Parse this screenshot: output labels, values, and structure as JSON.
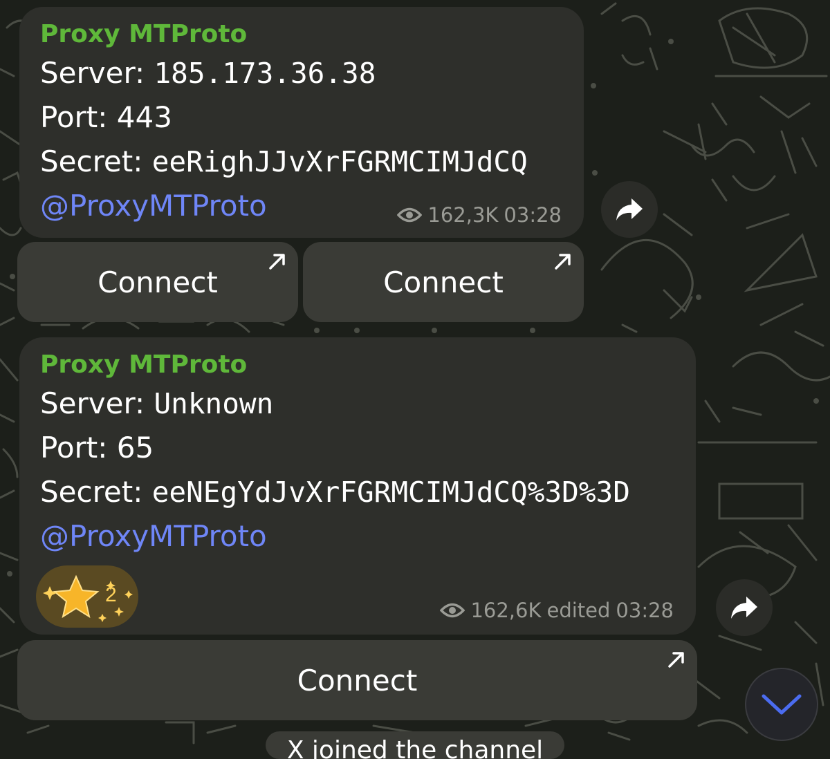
{
  "messages": [
    {
      "sender": "Proxy MTProto",
      "server_label": "Server: ",
      "server_value": "185.173.36.38",
      "port_label": "Port: ",
      "port_value": "443",
      "secret_label": "Secret: ",
      "secret_value": "eeRighJJvXrFGRMCIMJdCQ",
      "link": "@ProxyMTProto",
      "views": "162,3K",
      "time": "03:28",
      "buttons": [
        "Connect",
        "Connect"
      ]
    },
    {
      "sender": "Proxy MTProto",
      "server_label": "Server: ",
      "server_value": "Unknown",
      "port_label": "Port: ",
      "port_value": "65",
      "secret_label": "Secret: ",
      "secret_value": "eeNEgYdJvXrFGRMCIMJdCQ%3D%3D",
      "link": "@ProxyMTProto",
      "reaction": {
        "icon": "star-icon",
        "count": "2"
      },
      "views": "162,6K",
      "edited": "edited",
      "time": "03:28",
      "buttons": [
        "Connect"
      ]
    }
  ],
  "service_message": "X joined the channel",
  "colors": {
    "sender": "#5fb83a",
    "link": "#6f86f7",
    "bubble": "#2e2f2b",
    "button": "#3a3b36",
    "scroll_chevron": "#4b6cf0"
  },
  "icons": {
    "views": "eye-icon",
    "share": "share-arrow-icon",
    "external": "external-arrow-icon",
    "scroll": "chevron-down-icon"
  }
}
